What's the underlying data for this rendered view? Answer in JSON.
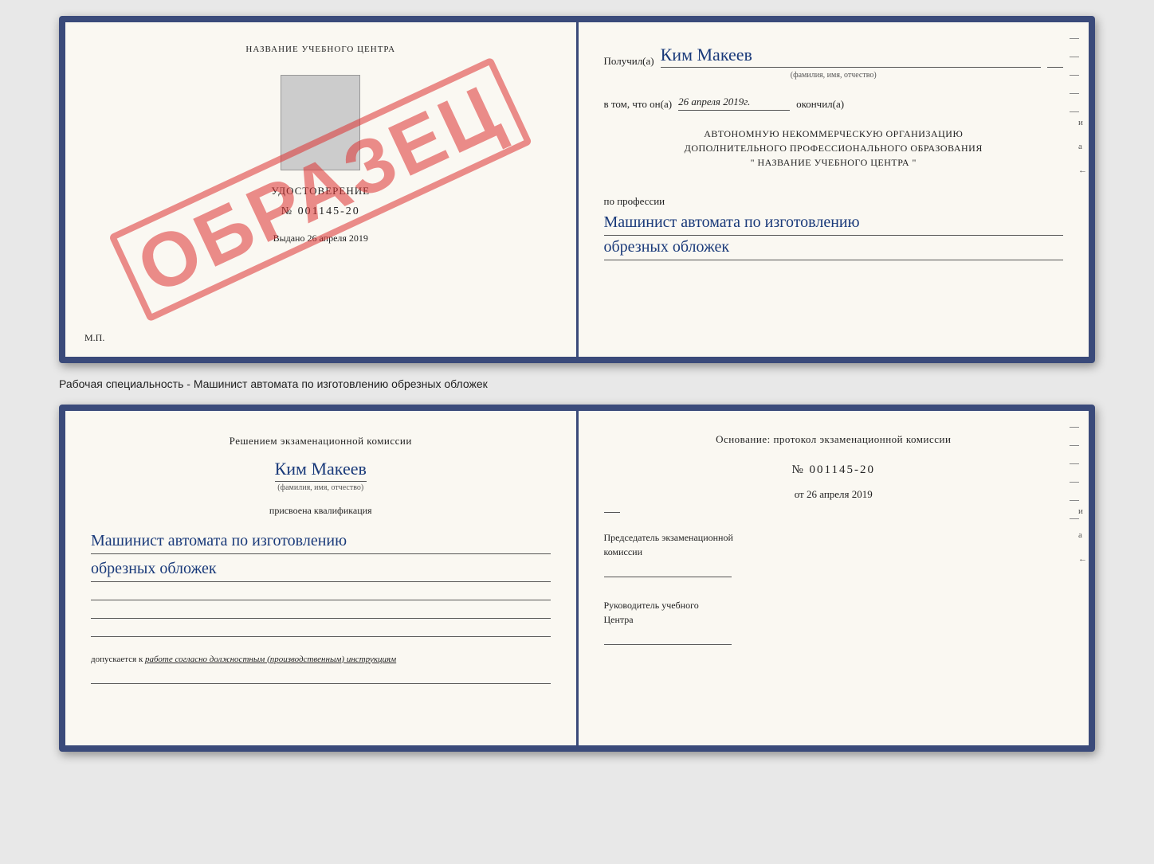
{
  "top_document": {
    "left_page": {
      "school_name": "НАЗВАНИЕ УЧЕБНОГО ЦЕНТРА",
      "cert_title": "УДОСТОВЕРЕНИЕ",
      "cert_number": "№ 001145-20",
      "issued_label": "Выдано",
      "issued_date": "26 апреля 2019",
      "mp_label": "М.П.",
      "watermark": "ОБРАЗЕЦ"
    },
    "right_page": {
      "recipient_prefix": "Получил(а)",
      "recipient_name": "Ким Макеев",
      "fio_caption": "(фамилия, имя, отчество)",
      "date_prefix": "в том, что он(а)",
      "date_value": "26 апреля 2019г.",
      "finished_label": "окончил(а)",
      "org_line1": "АВТОНОМНУЮ НЕКОММЕРЧЕСКУЮ ОРГАНИЗАЦИЮ",
      "org_line2": "ДОПОЛНИТЕЛЬНОГО ПРОФЕССИОНАЛЬНОГО ОБРАЗОВАНИЯ",
      "org_line3": "\"  НАЗВАНИЕ УЧЕБНОГО ЦЕНТРА  \"",
      "profession_label": "по профессии",
      "profession_line1": "Машинист автомата по изготовлению",
      "profession_line2": "обрезных обложек",
      "dash": "–"
    }
  },
  "specialty_label": "Рабочая специальность - Машинист автомата по изготовлению обрезных обложек",
  "bottom_document": {
    "left_page": {
      "commission_line1": "Решением экзаменационной комиссии",
      "person_name": "Ким Макеев",
      "fio_caption": "(фамилия, имя, отчество)",
      "qualification_label": "присвоена квалификация",
      "qualification_line1": "Машинист автомата по изготовлению",
      "qualification_line2": "обрезных обложек",
      "allowed_prefix": "допускается к",
      "allowed_text": "работе согласно должностным (производственным) инструкциям"
    },
    "right_page": {
      "basis_label": "Основание: протокол экзаменационной комиссии",
      "protocol_number": "№  001145-20",
      "date_prefix": "от",
      "date_value": "26 апреля 2019",
      "chairman_line1": "Председатель экзаменационной",
      "chairman_line2": "комиссии",
      "director_line1": "Руководитель учебного",
      "director_line2": "Центра",
      "dash": "–"
    }
  }
}
